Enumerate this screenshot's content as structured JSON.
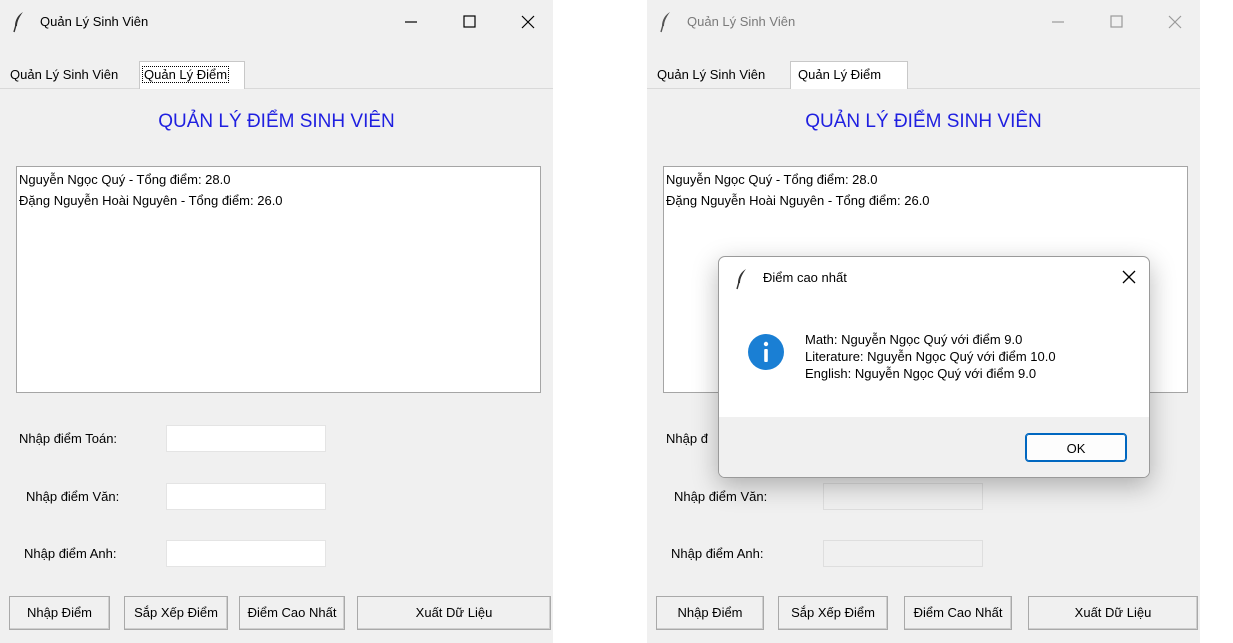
{
  "left_window": {
    "title": "Quản Lý Sinh Viên",
    "tabs": [
      "Quản Lý Sinh Viên",
      "Quản Lý Điểm"
    ],
    "heading": "QUẢN LÝ ĐIỂM SINH VIÊN",
    "list_items": [
      "Nguyễn Ngọc Quý - Tổng điểm: 28.0",
      "Đặng Nguyễn Hoài Nguyên - Tổng điểm: 26.0"
    ],
    "labels": [
      "Nhập điểm Toán:",
      "Nhập điểm Văn:",
      "Nhập điểm Anh:"
    ],
    "buttons": [
      "Nhập Điểm",
      "Sắp Xếp Điểm",
      "Điểm Cao Nhất",
      "Xuất Dữ Liệu"
    ]
  },
  "right_window": {
    "title": "Quản Lý Sinh Viên",
    "tabs": [
      "Quản Lý Sinh Viên",
      "Quản Lý Điểm"
    ],
    "heading": "QUẢN LÝ ĐIỂM SINH VIÊN",
    "list_items": [
      "Nguyễn Ngọc Quý - Tổng điểm: 28.0",
      "Đặng Nguyễn Hoài Nguyên - Tổng điểm: 26.0"
    ],
    "labels": [
      "Nhập đ",
      "Nhập điểm Văn:",
      "Nhập điểm Anh:"
    ],
    "buttons": [
      "Nhập Điểm",
      "Sắp Xếp Điểm",
      "Điểm Cao Nhất",
      "Xuất Dữ Liệu"
    ]
  },
  "dialog": {
    "title": "Điểm cao nhất",
    "messages": [
      "Math: Nguyễn Ngọc Quý với điểm 9.0",
      "Literature: Nguyễn Ngọc Quý với điểm 10.0",
      "English: Nguyễn Ngọc Quý với điểm 9.0"
    ],
    "ok_label": "OK"
  },
  "icons": {
    "app": "feather-icon",
    "minimize": "minimize-icon",
    "maximize": "maximize-icon",
    "close": "close-icon",
    "info": "info-icon"
  },
  "colors": {
    "heading": "#1f1fe0",
    "info_icon": "#1a7fd4",
    "ok_border": "#0067c0",
    "window_bg": "#f0f0f0"
  }
}
